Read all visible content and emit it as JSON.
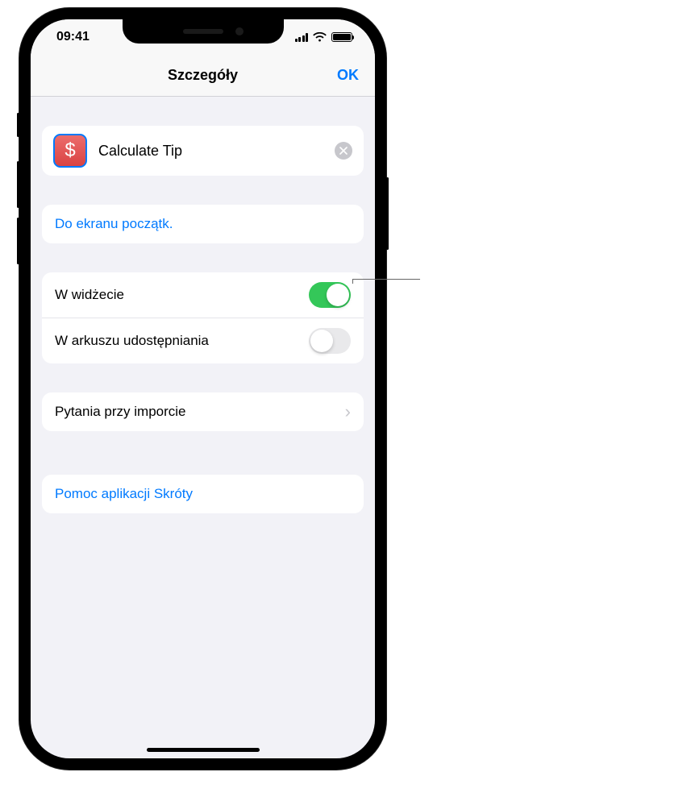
{
  "status": {
    "time": "09:41"
  },
  "nav": {
    "title": "Szczegóły",
    "ok": "OK"
  },
  "shortcut": {
    "iconGlyph": "$",
    "name": "Calculate Tip"
  },
  "actions": {
    "addToHome": "Do ekranu początk."
  },
  "toggles": {
    "widget": {
      "label": "W widżecie",
      "on": true
    },
    "shareSheet": {
      "label": "W arkuszu udostępniania",
      "on": false
    }
  },
  "importQuestions": "Pytania przy imporcie",
  "help": "Pomoc aplikacji Skróty"
}
